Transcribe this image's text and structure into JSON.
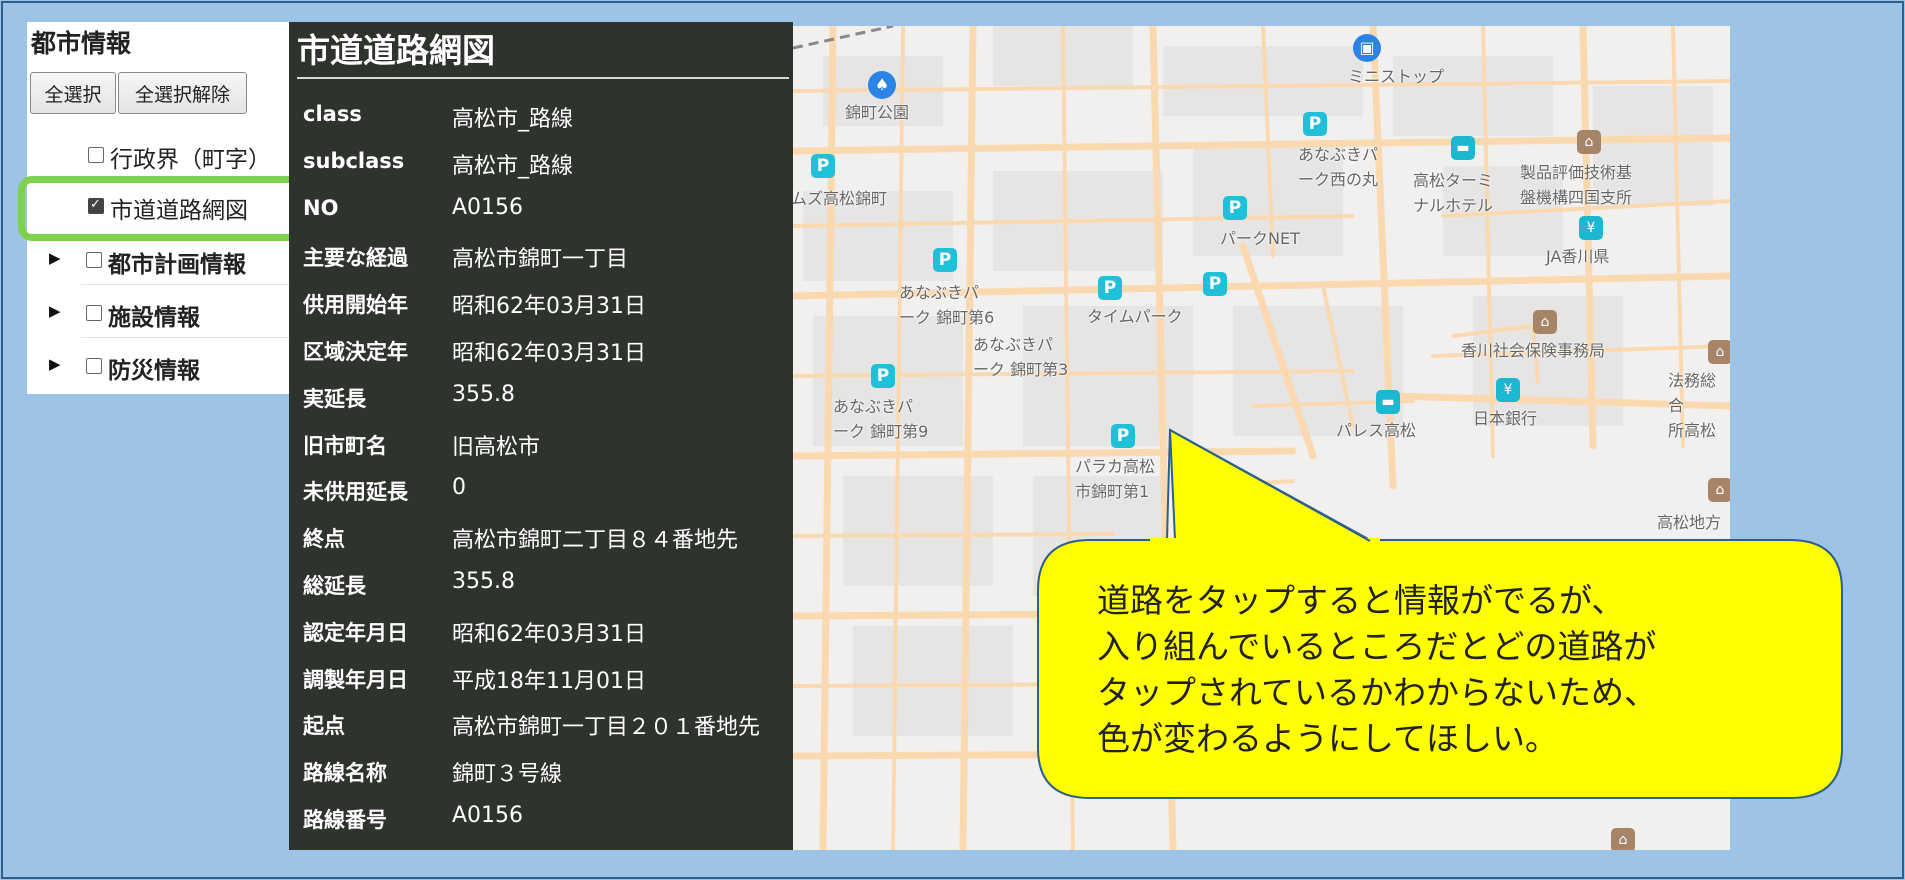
{
  "layer_panel": {
    "title": "都市情報",
    "select_all_label": "全選択",
    "deselect_all_label": "全選択解除",
    "items": [
      {
        "label": "行政界（町字）",
        "checked": false,
        "expandable": false,
        "bold": false
      },
      {
        "label": "市道道路網図",
        "checked": true,
        "expandable": false,
        "bold": false
      },
      {
        "label": "都市計画情報",
        "checked": false,
        "expandable": true,
        "bold": true
      },
      {
        "label": "施設情報",
        "checked": false,
        "expandable": true,
        "bold": true
      },
      {
        "label": "防災情報",
        "checked": false,
        "expandable": true,
        "bold": true
      }
    ]
  },
  "info_panel": {
    "title": "市道道路網図",
    "rows": [
      {
        "key": "class",
        "value": "高松市_路線"
      },
      {
        "key": "subclass",
        "value": "高松市_路線"
      },
      {
        "key": "NO",
        "value": "A0156"
      },
      {
        "key": "主要な経過",
        "value": "高松市錦町一丁目"
      },
      {
        "key": "供用開始年",
        "value": "昭和62年03月31日"
      },
      {
        "key": "区域決定年",
        "value": "昭和62年03月31日"
      },
      {
        "key": "実延長",
        "value": "355.8"
      },
      {
        "key": "旧市町名",
        "value": "旧高松市"
      },
      {
        "key": "未供用延長",
        "value": "0"
      },
      {
        "key": "終点",
        "value": "高松市錦町二丁目８４番地先"
      },
      {
        "key": "総延長",
        "value": "355.8"
      },
      {
        "key": "認定年月日",
        "value": "昭和62年03月31日"
      },
      {
        "key": "調製年月日",
        "value": "平成18年11月01日"
      },
      {
        "key": "起点",
        "value": "高松市錦町一丁目２０１番地先"
      },
      {
        "key": "路線名称",
        "value": "錦町３号線"
      },
      {
        "key": "路線番号",
        "value": "A0156"
      }
    ]
  },
  "map": {
    "labels": {
      "nishikimachi_park": "錦町公園",
      "mini_stop": "ミニストップ",
      "anabuki_nishinomaru": "あなぶきパ\nーク西の丸",
      "takamatsu_terminal_hotel": "高松ターミ\nナルホテル",
      "nite": "製品評価技術基\n盤機構四国支所",
      "takamatsu_nishikimachi": "ムズ高松錦町",
      "park_net": "パークNET",
      "ja_kagawa": "JA香川県",
      "anabuki_6": "あなぶきパ\nーク 錦町第6",
      "times_park": "タイムパーク",
      "anabuki_3": "あなぶきパ\nーク 錦町第3",
      "social_insurance": "香川社会保険事務局",
      "legal_affairs": "法務総合\n所高松",
      "anabuki_9": "あなぶきパ\nーク 錦町第9",
      "palace_takamatsu": "パレス高松",
      "bank_of_japan": "日本銀行",
      "paraka": "パラカ高松\n市錦町第1",
      "takamatsu_district": "高松地方"
    },
    "colors": {
      "road": "#fad9b0",
      "background": "#f1f0ee",
      "parking": "#21c0d9",
      "civic": "#a58468"
    }
  },
  "callout": {
    "text": "道路をタップすると情報がでるが、\n入り組んでいるところだとどの道路が\nタップされているかわからないため、\n色が変わるようにしてほしい。",
    "fill": "#ffff00"
  }
}
